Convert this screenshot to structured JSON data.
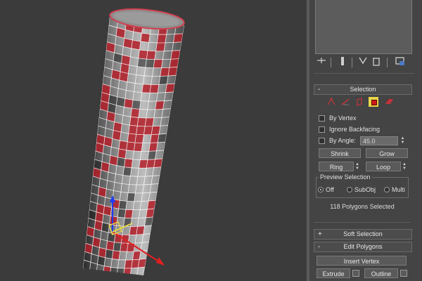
{
  "toolbar": {
    "icons": [
      "pin-stack-icon",
      "show-end-result-icon",
      "make-unique-icon",
      "remove-modifier-icon",
      "configure-modifier-sets-icon"
    ]
  },
  "selection": {
    "title": "Selection",
    "modes": [
      "vertex-icon",
      "edge-icon",
      "border-icon",
      "polygon-icon",
      "element-icon"
    ],
    "active_mode": "polygon-icon",
    "by_vertex": "By Vertex",
    "ignore_backfacing": "Ignore Backfacing",
    "by_angle": "By Angle:",
    "by_angle_value": "45.0",
    "shrink": "Shrink",
    "grow": "Grow",
    "ring": "Ring",
    "loop": "Loop",
    "preview_title": "Preview Selection",
    "preview_off": "Off",
    "preview_subobj": "SubObj",
    "preview_multi": "Multi",
    "preview_selected": "Off",
    "status": "118 Polygons Selected"
  },
  "soft_selection": {
    "title": "Soft Selection",
    "sign": "+"
  },
  "edit_polygons": {
    "title": "Edit Polygons",
    "sign": "-",
    "insert_vertex": "Insert Vertex",
    "extrude": "Extrude",
    "outline": "Outline"
  },
  "colors": {
    "selected_face": "#b3202a",
    "wire": "#ffffff",
    "highlight": "#e8d64a"
  }
}
